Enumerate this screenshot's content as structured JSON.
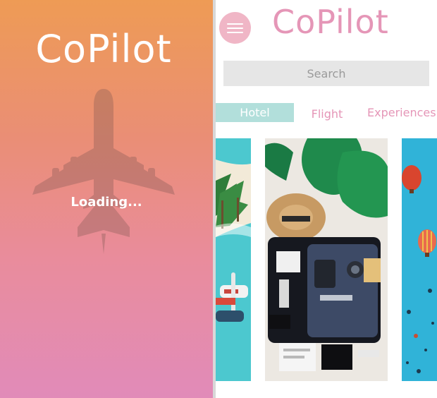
{
  "splash": {
    "title": "CoPilot",
    "loading_text": "Loading..."
  },
  "home": {
    "title": "CoPilot",
    "search": {
      "placeholder": "Search",
      "value": ""
    },
    "tabs": [
      {
        "label": "Hotel",
        "active": true
      },
      {
        "label": "Flight",
        "active": false
      },
      {
        "label": "Experiences",
        "active": false
      }
    ],
    "cards": [
      {
        "name": "beach"
      },
      {
        "name": "suitcase"
      },
      {
        "name": "balloons"
      }
    ]
  },
  "colors": {
    "splash_top": "#ee9b55",
    "splash_bottom": "#e18bb9",
    "brand_pink": "#e596b7",
    "menu_button": "#f0b6c6",
    "active_tab": "#b2dfdb",
    "search_bg": "#e6e6e6"
  },
  "icons": [
    "airplane-icon",
    "hamburger-menu-icon"
  ]
}
